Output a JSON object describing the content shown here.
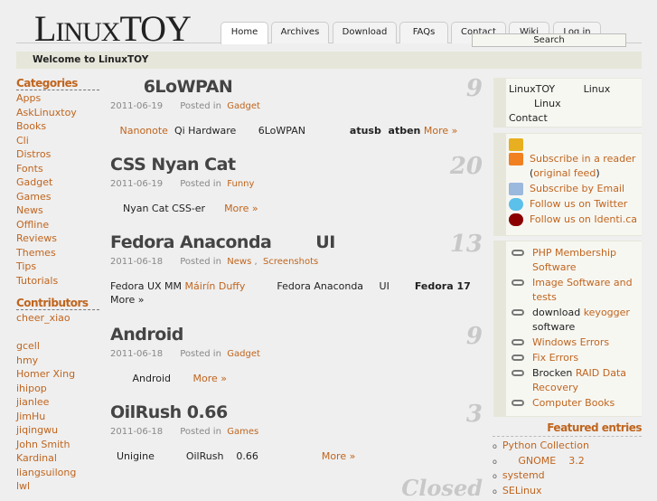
{
  "site": {
    "logo": "LinuxTOY",
    "logo_parts": [
      "L",
      "INUX",
      "TOY"
    ],
    "welcome": "Welcome to LinuxTOY"
  },
  "nav": {
    "tabs": [
      "Home",
      "Archives",
      "Download",
      "FAQs",
      "Contact",
      "Wiki",
      "Log in"
    ],
    "active": "Home",
    "search_label": "Search"
  },
  "sidebar_left": {
    "categories_title": "Categories",
    "categories": [
      "Apps",
      "AskLinuxtoy",
      "Books",
      "Cli",
      "Distros",
      "Fonts",
      "Gadget",
      "Games",
      "News",
      "Offline",
      "Reviews",
      "Themes",
      "Tips",
      "Tutorials"
    ],
    "contributors_title": "Contributors",
    "contributors": [
      "cheer_xiao",
      "",
      "gcell",
      "hmy",
      "Homer Xing",
      "ihipop",
      "jianlee",
      "JimHu",
      "jiqingwu",
      "John Smith",
      "Kardinal",
      "liangsuilong",
      "lwl"
    ]
  },
  "posts": [
    {
      "title": "      6LoWPAN",
      "date": "2011-06-19",
      "posted_in": "Posted in",
      "cats": [
        "Gadget"
      ],
      "comments": "9",
      "excerpt": [
        {
          "t": "   "
        },
        {
          "t": "Nanonote",
          "l": 1
        },
        {
          "t": "  Qi Hardware       6LoWPAN              "
        },
        {
          "t": "atusb  atben",
          "b": 1
        },
        {
          "t": " "
        },
        {
          "t": "More »",
          "l": 1
        }
      ]
    },
    {
      "title": "CSS Nyan Cat",
      "date": "2011-06-19",
      "posted_in": "Posted in",
      "cats": [
        "Funny"
      ],
      "comments": "20",
      "excerpt": [
        {
          "t": "    Nyan Cat CSS-er      "
        },
        {
          "t": "More »",
          "l": 1
        }
      ]
    },
    {
      "title": "Fedora Anaconda        UI",
      "date": "2011-06-18",
      "posted_in": "Posted in",
      "cats": [
        "News",
        "Screenshots"
      ],
      "comments": "13",
      "excerpt": [
        {
          "t": "Fedora UX MM "
        },
        {
          "t": "Máirín Duffy",
          "l": 1
        },
        {
          "t": "          Fedora Anaconda     UI        "
        },
        {
          "t": "Fedora 17",
          "b": 1
        }
      ],
      "excerpt2": "More »"
    },
    {
      "title": "Android",
      "date": "2011-06-18",
      "posted_in": "Posted in",
      "cats": [
        "Gadget"
      ],
      "comments": "9",
      "excerpt": [
        {
          "t": "       Android       "
        },
        {
          "t": "More »",
          "l": 1
        }
      ]
    },
    {
      "title": "OilRush 0.66",
      "date": "2011-06-18",
      "posted_in": "Posted in",
      "cats": [
        "Games"
      ],
      "comments": "3",
      "excerpt": [
        {
          "t": "  Unigine          OilRush    0.66                    "
        },
        {
          "t": "More »",
          "l": 1
        }
      ]
    }
  ],
  "closed_label": "Closed",
  "sidebar_right": {
    "about": [
      "LinuxTOY         Linux",
      "        Linux",
      "Contact"
    ],
    "subscribe": [
      {
        "icon": "feed-stats-icon",
        "text": ""
      },
      {
        "icon": "rss-icon",
        "text": "Subscribe in a reader",
        "sub": "original feed"
      },
      {
        "icon": "email-icon",
        "text": "Subscribe by Email"
      },
      {
        "icon": "twitter-icon",
        "text": "Follow us on Twitter"
      },
      {
        "icon": "identica-icon",
        "text": "Follow us on Identi.ca"
      }
    ],
    "links": [
      {
        "pre": "",
        "link": "PHP Membership Software",
        "post": ""
      },
      {
        "pre": "",
        "link": "Image Software and tests",
        "post": ""
      },
      {
        "pre": "download ",
        "link": "keyogger",
        "post": " software"
      },
      {
        "pre": "",
        "link": "Windows Errors",
        "post": ""
      },
      {
        "pre": "",
        "link": "Fix Errors",
        "post": ""
      },
      {
        "pre": "Brocken ",
        "link": "RAID Data Recovery",
        "post": ""
      },
      {
        "pre": "",
        "link": "Computer Books",
        "post": ""
      }
    ],
    "featured_title": "Featured entries",
    "featured": [
      "Python Collection",
      "     GNOME    3.2",
      "systemd",
      "SELinux"
    ]
  },
  "colors": {
    "link": "#c0651e",
    "bar": "#e6e6da",
    "bg": "#efefef"
  }
}
